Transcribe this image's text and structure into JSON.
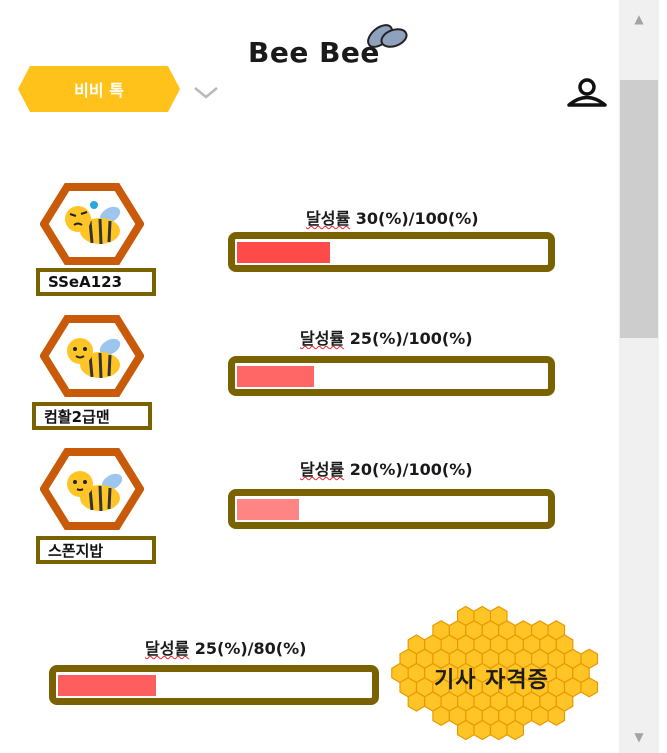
{
  "header": {
    "logo_text": "Bee Bee",
    "talk_tab_label": "비비 톡"
  },
  "users": [
    {
      "name": "SSeA123",
      "rate_prefix": "달성률",
      "rate_text": " 30(%)/100(%)",
      "progress": 0.3,
      "fill_color": "#ff4a4a"
    },
    {
      "name": "컴활2급맨",
      "rate_prefix": "달성률",
      "rate_text": " 25(%)/100(%)",
      "progress": 0.25,
      "fill_color": "#ff6666"
    },
    {
      "name": "스폰지밥",
      "rate_prefix": "달성률",
      "rate_text": " 20(%)/100(%)",
      "progress": 0.2,
      "fill_color": "#ff8585"
    }
  ],
  "summary": {
    "rate_prefix": "달성률",
    "rate_text": " 25(%)/80(%)",
    "progress": 0.3125,
    "fill_color": "#ff5e5e"
  },
  "certificate": {
    "label": "기사 자격증"
  },
  "colors": {
    "accent_yellow": "#ffc21a",
    "frame_brown": "#7a6200",
    "hex_orange": "#c85a0a",
    "honey": "#ffc527"
  },
  "icons": [
    "bee-wings-icon",
    "chevron-down-icon",
    "user-icon",
    "bee-avatar-icon",
    "honeycomb-icon"
  ]
}
